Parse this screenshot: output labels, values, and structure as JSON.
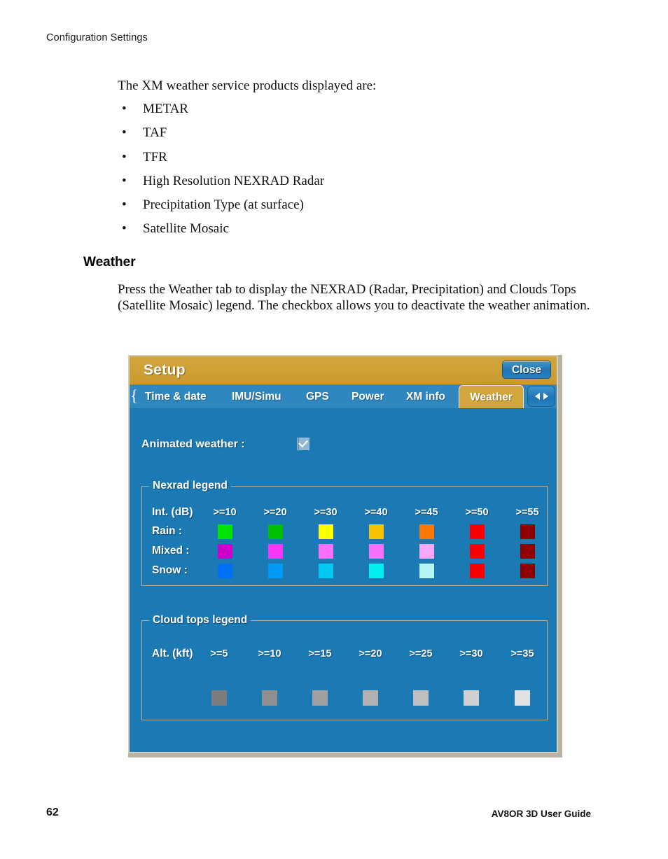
{
  "document": {
    "running_header": "Configuration Settings",
    "page_number": "62",
    "guide_title": "AV8OR 3D User Guide",
    "intro_line": "The XM weather service products displayed are:",
    "bullets": [
      "METAR",
      "TAF",
      "TFR",
      "High Resolution NEXRAD Radar",
      "Precipitation Type (at surface)",
      "Satellite Mosaic"
    ],
    "section_heading": "Weather",
    "section_paragraph": "Press the Weather tab to display the NEXRAD (Radar, Precipitation) and Clouds Tops (Satellite Mosaic) legend. The checkbox allows you to deactivate the weather animation."
  },
  "dialog": {
    "title": "Setup",
    "close_label": "Close",
    "tabs": [
      {
        "label": "Time & date",
        "active": false
      },
      {
        "label": "IMU/Simu",
        "active": false
      },
      {
        "label": "GPS",
        "active": false
      },
      {
        "label": "Power",
        "active": false
      },
      {
        "label": "XM info",
        "active": false
      },
      {
        "label": "Weather",
        "active": true
      }
    ],
    "tab_nav": {
      "prev_icon": "triangle-left-icon",
      "next_icon": "triangle-right-icon"
    },
    "animated_weather": {
      "label": "Animated weather :",
      "checked": true
    },
    "nexrad_legend": {
      "title": "Nexrad legend",
      "row_header": "Int. (dB)",
      "columns": [
        ">=10",
        ">=20",
        ">=30",
        ">=40",
        ">=45",
        ">=50",
        ">=55"
      ],
      "rows": [
        {
          "label": "Rain :",
          "colors": [
            "#00e400",
            "#00bf00",
            "#ffff00",
            "#f9c200",
            "#fc7703",
            "#fa0000",
            "#8e0000"
          ]
        },
        {
          "label": "Mixed :",
          "colors": [
            "#ce00ce",
            "#f736f7",
            "#f96ff9",
            "#f96ff9",
            "#faa8fa",
            "#fa0000",
            "#8e0000"
          ]
        },
        {
          "label": "Snow :",
          "colors": [
            "#0070f5",
            "#009bf7",
            "#00c8f0",
            "#00efef",
            "#b4f6f6",
            "#fa0000",
            "#8e0000"
          ]
        }
      ]
    },
    "cloud_tops_legend": {
      "title": "Cloud tops legend",
      "row_header": "Alt. (kft)",
      "columns": [
        ">=5",
        ">=10",
        ">=15",
        ">=20",
        ">=25",
        ">=30",
        ">=35"
      ],
      "colors": [
        "#7d7d7d",
        "#8f8f8f",
        "#a0a0a0",
        "#b1b1b1",
        "#bfbfbf",
        "#d0d0d0",
        "#e0e2e4"
      ]
    },
    "colors": {
      "panel_blue": "#1b79b4",
      "tabbar_blue": "#2f87c0",
      "title_gold": "#cfa239",
      "active_tab_gold": "#d2a53d",
      "border_tan": "#d6cfbb",
      "button_blue": "#2a82c0"
    }
  }
}
